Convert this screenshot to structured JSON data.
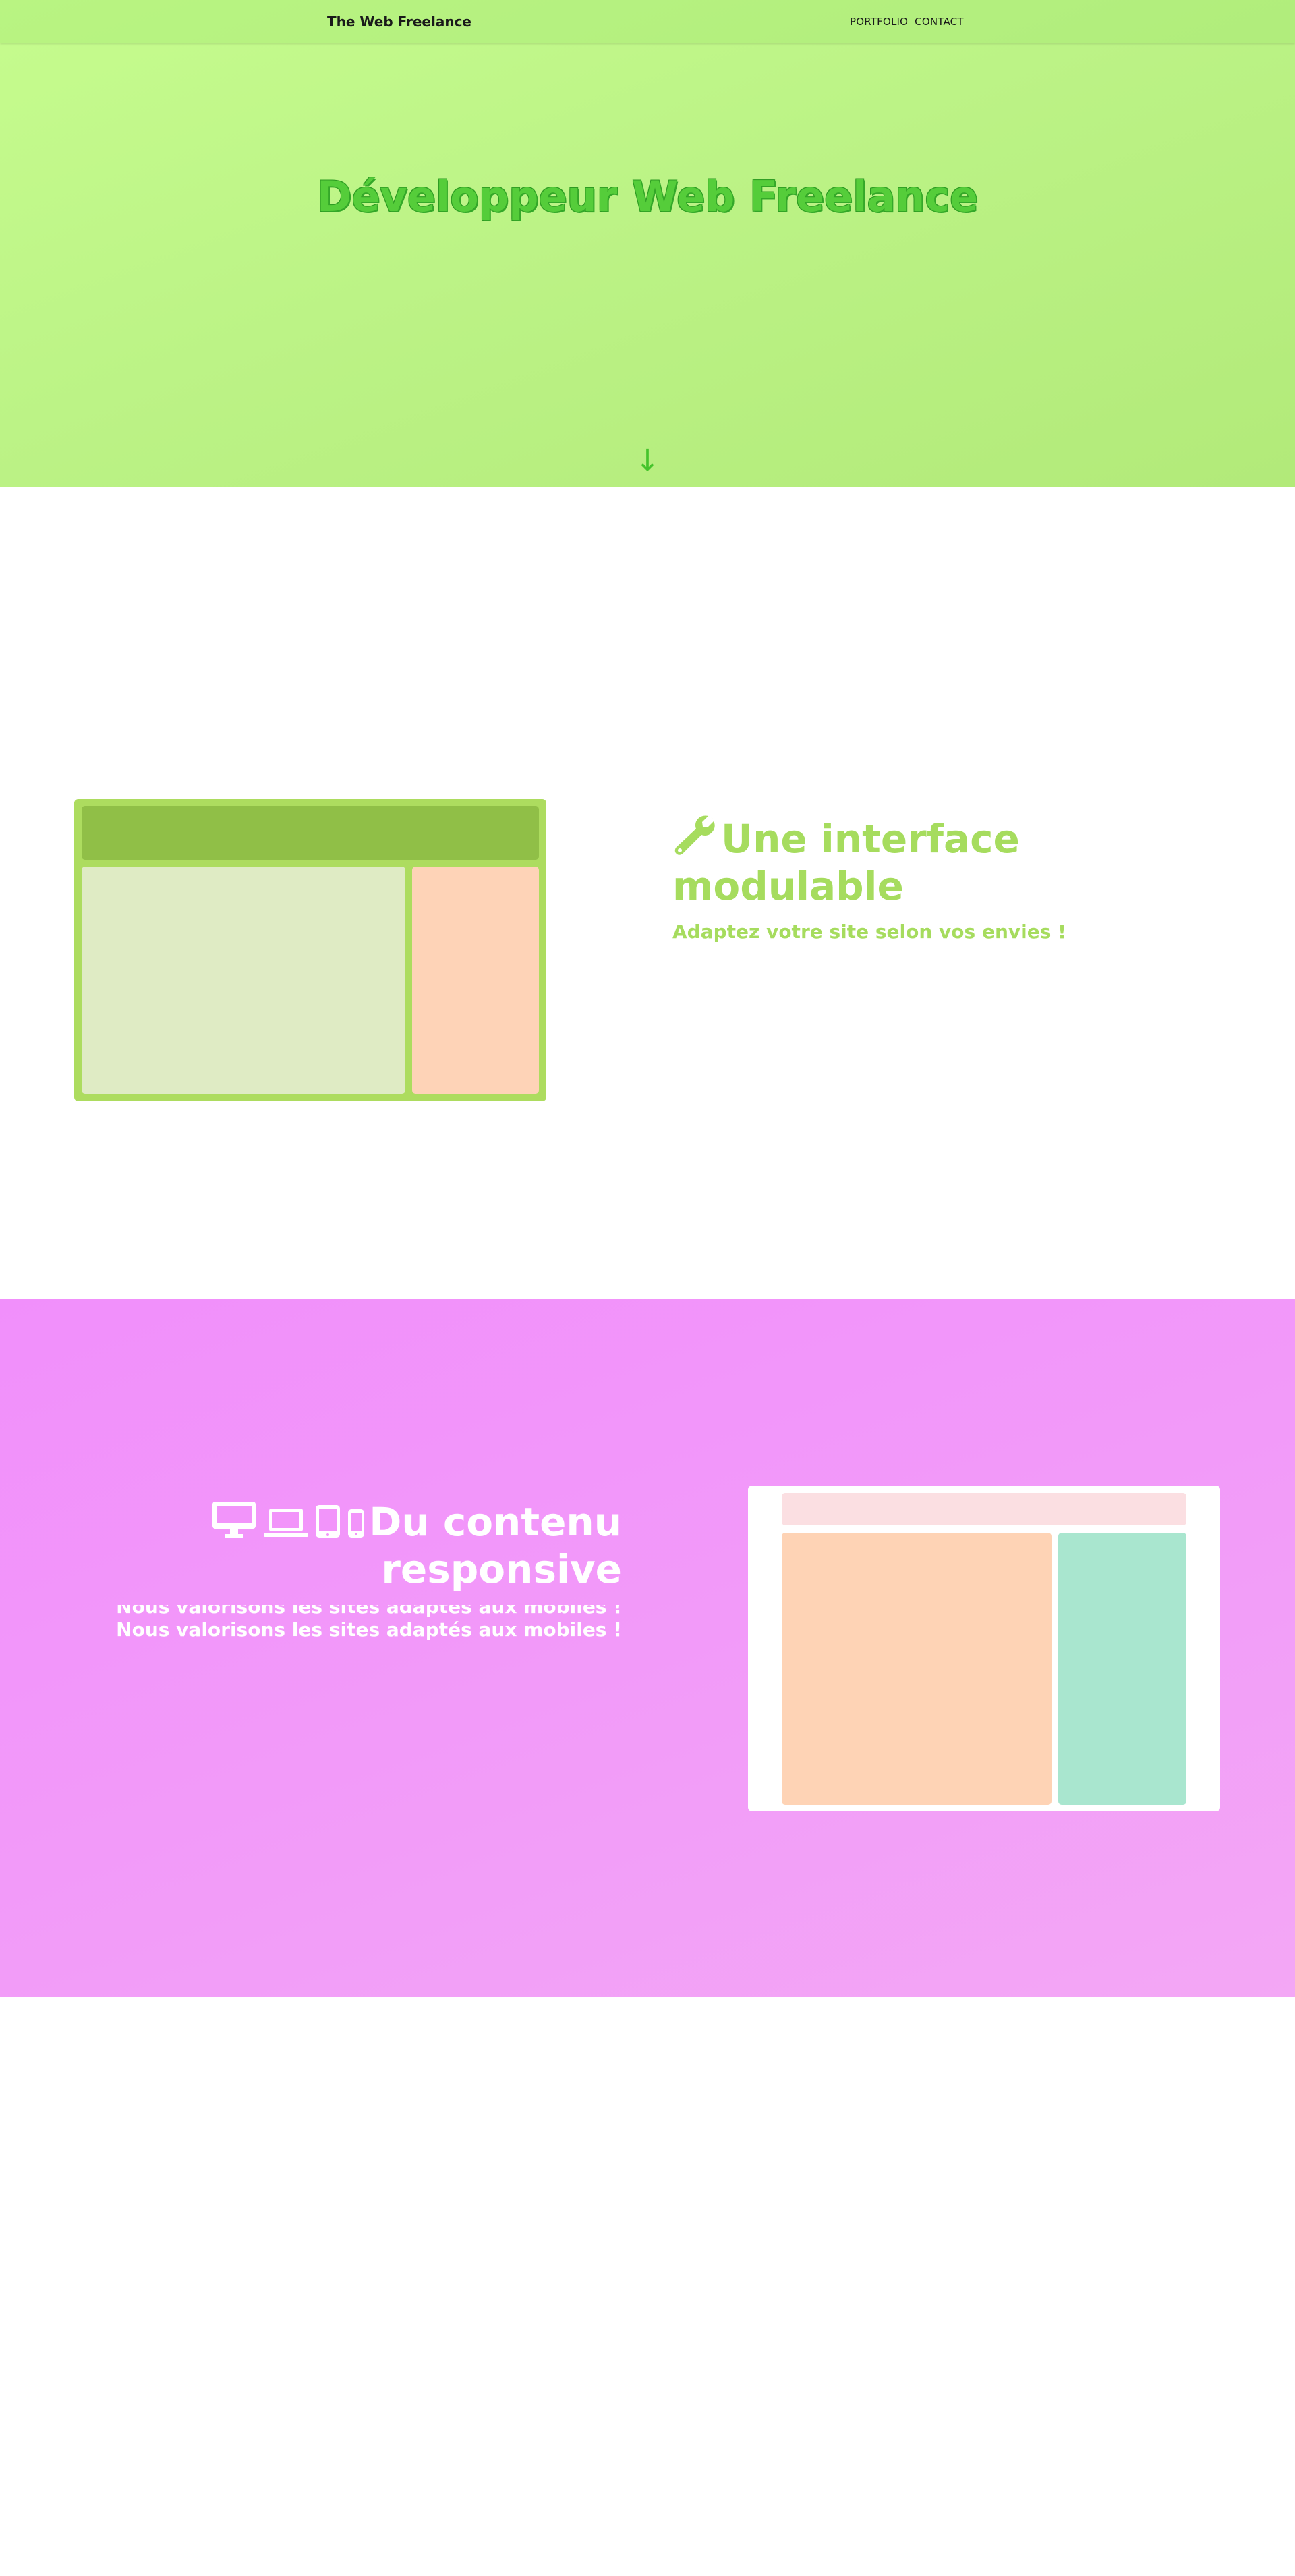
{
  "header": {
    "brand": "The Web Freelance",
    "nav": [
      "PORTFOLIO",
      "CONTACT"
    ]
  },
  "hero": {
    "title": "Développeur Web Freelance",
    "scroll_glyph": "↓"
  },
  "feature_modulable": {
    "icon": "wrench-icon",
    "title": "Une interface modulable",
    "subtitle": "Adaptez votre site selon vos envies !"
  },
  "feature_responsive": {
    "icons": [
      "desktop-icon",
      "laptop-icon",
      "tablet-icon",
      "mobile-icon"
    ],
    "title": "Du contenu responsive",
    "subtitle": "Nous valorisons les sites adaptés aux mobiles !"
  },
  "colors": {
    "hero_green": "#c1f98b",
    "title_green": "#55cd3a",
    "feature_green": "#a6dc5e",
    "pink": "#f294fa",
    "white": "#ffffff"
  }
}
